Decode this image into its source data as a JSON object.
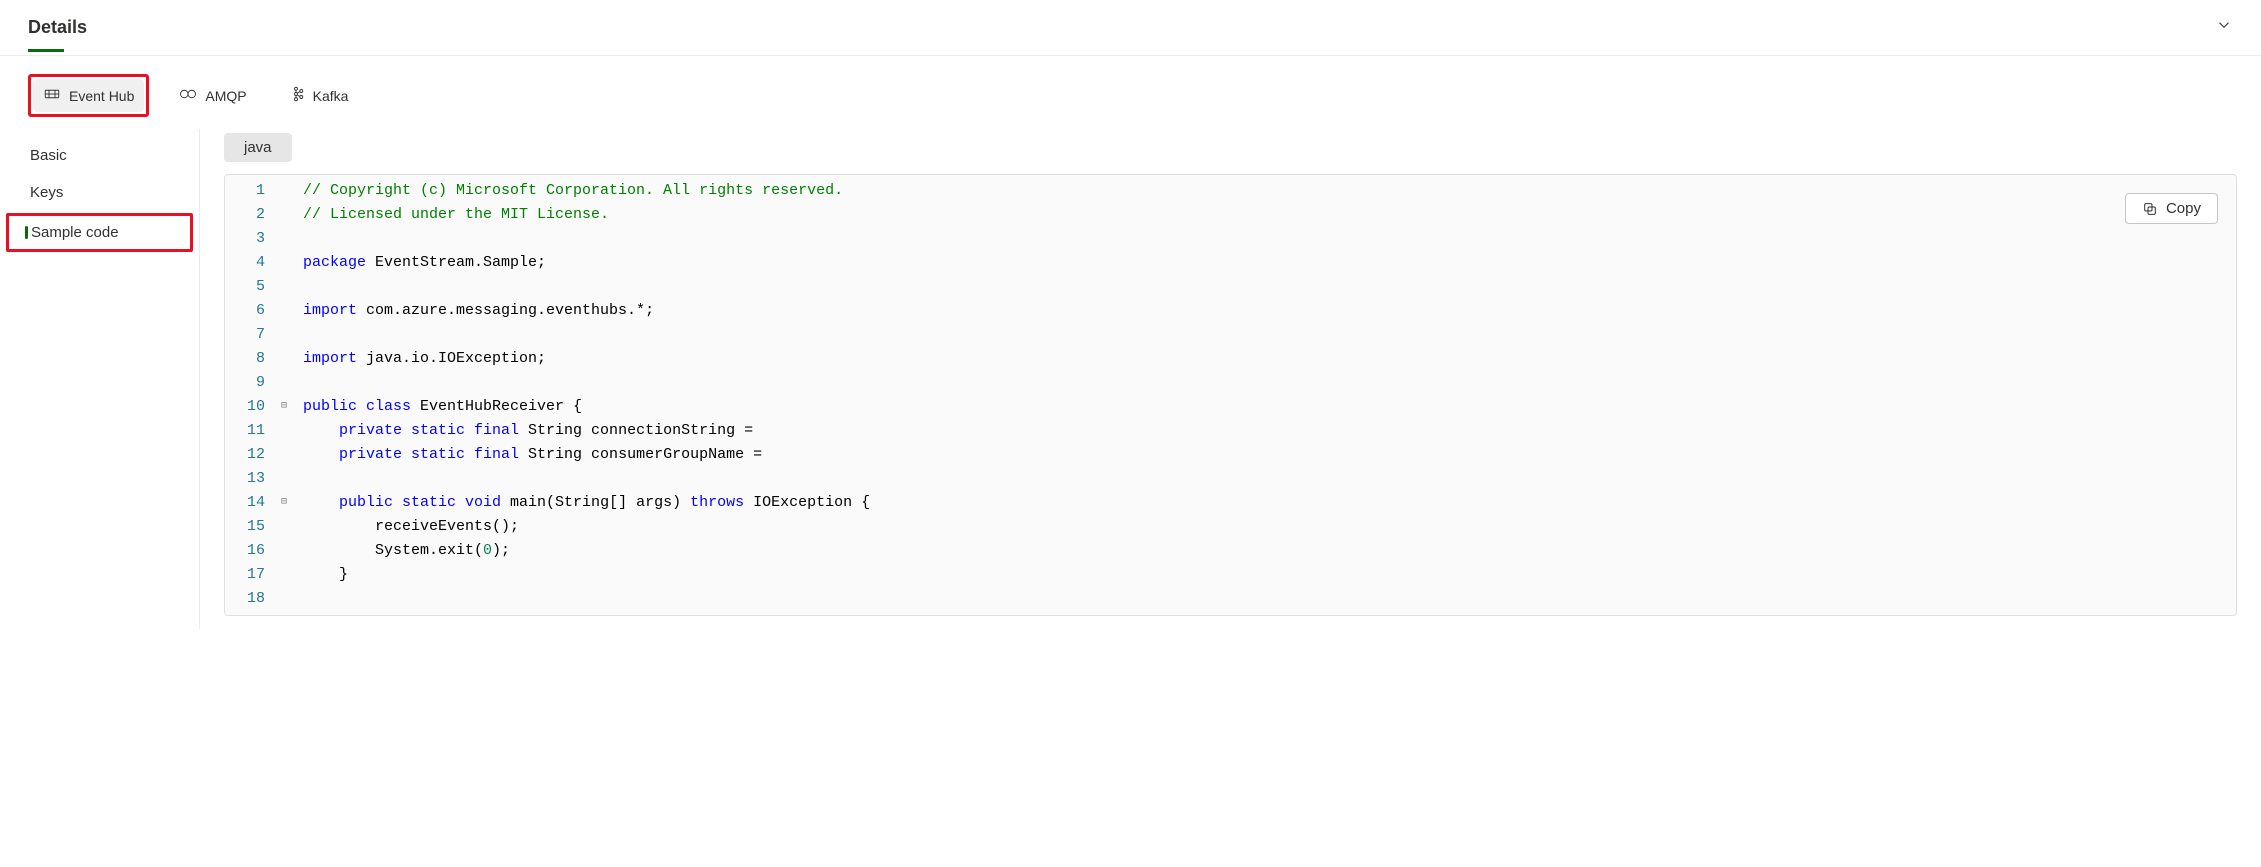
{
  "header": {
    "title": "Details"
  },
  "protocols": [
    {
      "label": "Event Hub",
      "active": true,
      "icon": "eventhub-icon",
      "highlight": true
    },
    {
      "label": "AMQP",
      "active": false,
      "icon": "amqp-icon",
      "highlight": false
    },
    {
      "label": "Kafka",
      "active": false,
      "icon": "kafka-icon",
      "highlight": false
    }
  ],
  "sidebar": {
    "items": [
      {
        "label": "Basic",
        "active": false,
        "highlight": false
      },
      {
        "label": "Keys",
        "active": false,
        "highlight": false
      },
      {
        "label": "Sample code",
        "active": true,
        "highlight": true
      }
    ]
  },
  "language_pill": "java",
  "copy_label": "Copy",
  "code": {
    "lines": [
      {
        "n": 1,
        "fold": "",
        "tokens": [
          {
            "cls": "cm",
            "t": "// Copyright (c) Microsoft Corporation. All rights reserved."
          }
        ]
      },
      {
        "n": 2,
        "fold": "",
        "tokens": [
          {
            "cls": "cm",
            "t": "// Licensed under the MIT License."
          }
        ]
      },
      {
        "n": 3,
        "fold": "",
        "tokens": []
      },
      {
        "n": 4,
        "fold": "",
        "tokens": [
          {
            "cls": "kw",
            "t": "package"
          },
          {
            "cls": "pl",
            "t": " EventStream.Sample;"
          }
        ]
      },
      {
        "n": 5,
        "fold": "",
        "tokens": []
      },
      {
        "n": 6,
        "fold": "",
        "tokens": [
          {
            "cls": "kw",
            "t": "import"
          },
          {
            "cls": "pl",
            "t": " com.azure.messaging.eventhubs.*;"
          }
        ]
      },
      {
        "n": 7,
        "fold": "",
        "tokens": []
      },
      {
        "n": 8,
        "fold": "",
        "tokens": [
          {
            "cls": "kw",
            "t": "import"
          },
          {
            "cls": "pl",
            "t": " java.io.IOException;"
          }
        ]
      },
      {
        "n": 9,
        "fold": "",
        "tokens": []
      },
      {
        "n": 10,
        "fold": "⊟",
        "tokens": [
          {
            "cls": "kw",
            "t": "public class"
          },
          {
            "cls": "pl",
            "t": " EventHubReceiver {"
          }
        ]
      },
      {
        "n": 11,
        "fold": "",
        "tokens": [
          {
            "cls": "pl",
            "t": "    "
          },
          {
            "cls": "kw",
            "t": "private static final"
          },
          {
            "cls": "pl",
            "t": " String connectionString ="
          }
        ]
      },
      {
        "n": 12,
        "fold": "",
        "tokens": [
          {
            "cls": "pl",
            "t": "    "
          },
          {
            "cls": "kw",
            "t": "private static final"
          },
          {
            "cls": "pl",
            "t": " String consumerGroupName ="
          }
        ]
      },
      {
        "n": 13,
        "fold": "",
        "tokens": []
      },
      {
        "n": 14,
        "fold": "⊟",
        "tokens": [
          {
            "cls": "pl",
            "t": "    "
          },
          {
            "cls": "kw",
            "t": "public static void"
          },
          {
            "cls": "pl",
            "t": " main(String[] args) "
          },
          {
            "cls": "kw",
            "t": "throws"
          },
          {
            "cls": "pl",
            "t": " IOException {"
          }
        ]
      },
      {
        "n": 15,
        "fold": "",
        "tokens": [
          {
            "cls": "pl",
            "t": "        receiveEvents();"
          }
        ]
      },
      {
        "n": 16,
        "fold": "",
        "tokens": [
          {
            "cls": "pl",
            "t": "        System.exit("
          },
          {
            "cls": "num",
            "t": "0"
          },
          {
            "cls": "pl",
            "t": ");"
          }
        ]
      },
      {
        "n": 17,
        "fold": "",
        "tokens": [
          {
            "cls": "pl",
            "t": "    }"
          }
        ]
      },
      {
        "n": 18,
        "fold": "",
        "tokens": []
      }
    ]
  }
}
